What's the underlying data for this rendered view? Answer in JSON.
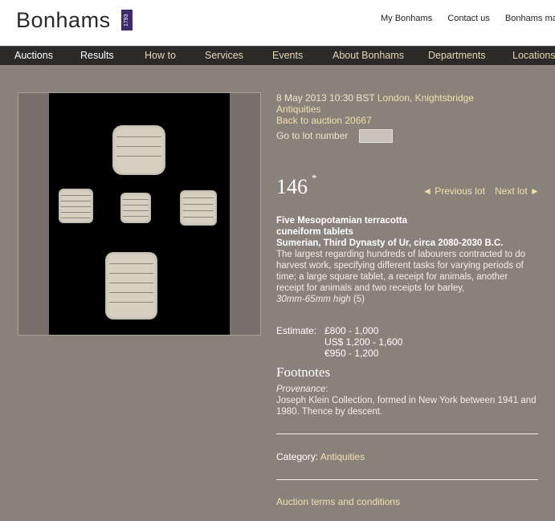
{
  "header": {
    "logo_text": "Bonhams",
    "logo_year": "1793",
    "links": [
      "My Bonhams",
      "Contact us",
      "Bonhams mag"
    ]
  },
  "nav": {
    "items": [
      "Auctions",
      "Results",
      "How to",
      "Services",
      "Events",
      "About Bonhams",
      "Departments",
      "Locations"
    ]
  },
  "sale": {
    "date": "8 May 2013 10:30 BST",
    "location": "London, Knightsbridge",
    "department": "Antiquities",
    "back_link": "Back to auction 20667",
    "goto_label": "Go to lot number"
  },
  "lot": {
    "number": "146",
    "star": "*",
    "prev_label": "◄ Previous lot",
    "next_label": "Next lot ►",
    "title_line1": "Five Mesopotamian terracotta",
    "title_line2": "cuneiform tablets",
    "subtitle": "Sumerian, Third Dynasty of Ur, circa 2080-2030 B.C.",
    "description": "The largest regarding hundreds of labourers contracted to do harvest work, specifying different tasks for varying periods of time; a large square tablet, a receipt for animals, another receipt for animals and two receipts for barley,",
    "dimensions": "30mm-65mm high",
    "count": "(5)"
  },
  "estimate": {
    "label": "Estimate:",
    "gbp": "£800 - 1,000",
    "usd": "US$ 1,200 - 1,600",
    "eur": "€950 - 1,200"
  },
  "footnotes": {
    "title": "Footnotes",
    "provenance_label": "Provenance",
    "provenance_text": "Joseph Klein Collection, formed in New York between 1941 and 1980. Thence by descent."
  },
  "category": {
    "label": "Category:",
    "value": "Antiquities"
  },
  "terms_link": "Auction terms and conditions",
  "colors": {
    "page_bg": "#8a827a",
    "nav_bg": "#2b2a28",
    "link": "#efe0b0",
    "logo_badge": "#3d2b6b"
  }
}
